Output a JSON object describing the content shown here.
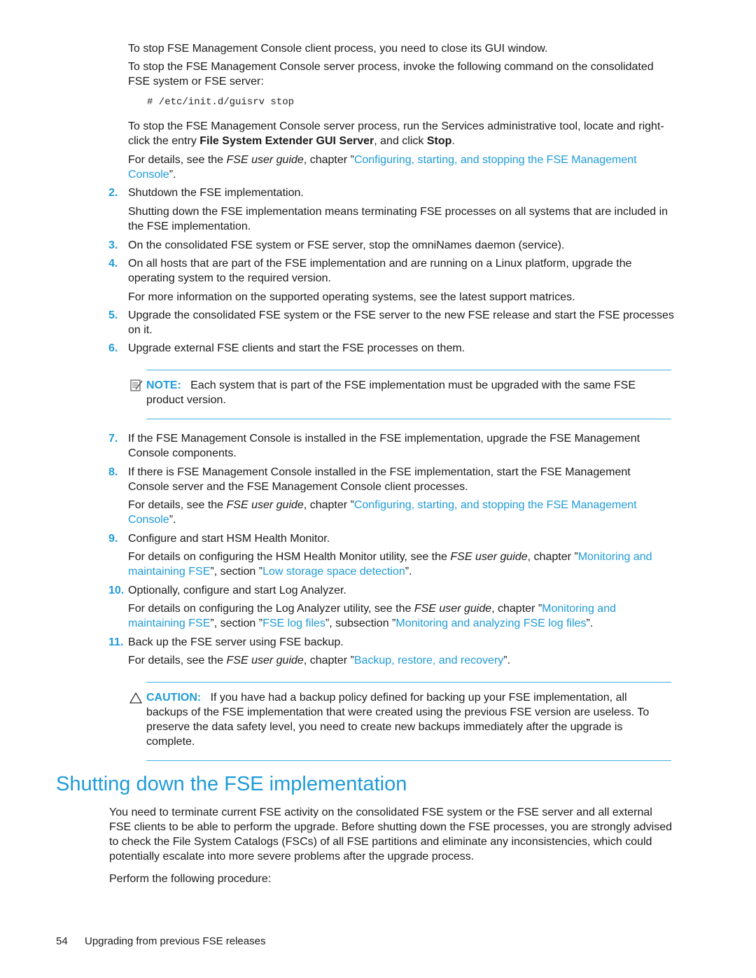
{
  "paragraphs": {
    "p1": "To stop FSE Management Console client process, you need to close its GUI window.",
    "p2": "To stop the FSE Management Console server process, invoke the following command on the consolidated FSE system or FSE server:",
    "cmd": "# /etc/init.d/guisrv stop",
    "p3a": "To stop the FSE Management Console server process, run the Services administrative tool, locate and right-click the entry ",
    "p3b": "File System Extender GUI Server",
    "p3c": ", and click ",
    "p3d": "Stop",
    "p3e": ".",
    "p4a": "For details, see the ",
    "p4b": "FSE user guide",
    "p4c": ", chapter ”",
    "p4link": "Configuring, starting, and stopping the FSE Management Console",
    "p4d": "”."
  },
  "steps": [
    {
      "num": "2.",
      "text": "Shutdown the FSE implementation.",
      "sub": "Shutting down the FSE implementation means terminating FSE processes on all systems that are included in the FSE implementation."
    },
    {
      "num": "3.",
      "text": "On the consolidated FSE system or FSE server, stop the omniNames daemon (service)."
    },
    {
      "num": "4.",
      "text": "On all hosts that are part of the FSE implementation and are running on a Linux platform, upgrade the operating system to the required version.",
      "sub": "For more information on the supported operating systems, see the latest support matrices."
    },
    {
      "num": "5.",
      "text": "Upgrade the consolidated FSE system or the FSE server to the new FSE release and start the FSE processes on it."
    },
    {
      "num": "6.",
      "text": "Upgrade external FSE clients and start the FSE processes on them."
    },
    {
      "num": "7.",
      "text": "If the FSE Management Console is installed in the FSE implementation, upgrade the FSE Management Console components."
    },
    {
      "num": "8.",
      "text": "If there is FSE Management Console installed in the FSE implementation, start the FSE Management Console server and the FSE Management Console client processes.",
      "sub_a": "For details, see the ",
      "sub_i": "FSE user guide",
      "sub_b": ", chapter ”",
      "sub_link": "Configuring, starting, and stopping the FSE Management Console",
      "sub_c": "”."
    },
    {
      "num": "9.",
      "text": "Configure and start HSM Health Monitor.",
      "sub_a": "For details on configuring the HSM Health Monitor utility, see the ",
      "sub_i": "FSE user guide",
      "sub_b": ", chapter ”",
      "sub_link": "Monitoring and maintaining FSE",
      "sub_c": "”, section ”",
      "sub_link2": "Low storage space detection",
      "sub_d": "”."
    },
    {
      "num": "10.",
      "text": "Optionally, configure and start Log Analyzer.",
      "sub_a": "For details on configuring the Log Analyzer utility, see the ",
      "sub_i": "FSE user guide",
      "sub_b": ", chapter ”",
      "sub_link": "Monitoring and maintaining FSE",
      "sub_c": "”, section ”",
      "sub_link2": "FSE log files",
      "sub_d": "”, subsection ”",
      "sub_link3": "Monitoring and analyzing FSE log files",
      "sub_e": "”."
    },
    {
      "num": "11.",
      "text": "Back up the FSE server using FSE backup.",
      "sub_a": "For details, see the ",
      "sub_i": "FSE user guide",
      "sub_b": ", chapter ”",
      "sub_link": "Backup, restore, and recovery",
      "sub_c": "”."
    }
  ],
  "note": {
    "icon": "note-icon",
    "label": "NOTE:",
    "text": "Each system that is part of the FSE implementation must be upgraded with the same FSE product version."
  },
  "caution": {
    "icon": "caution-icon",
    "label": "CAUTION:",
    "text": "If you have had a backup policy defined for backing up your FSE implementation, all backups of the FSE implementation that were created using the previous FSE version are useless. To preserve the data safety level, you need to create new backups immediately after the upgrade is complete."
  },
  "section": {
    "title": "Shutting down the FSE implementation",
    "p1": "You need to terminate current FSE activity on the consolidated FSE system or the FSE server and all external FSE clients to be able to perform the upgrade. Before shutting down the FSE processes, you are strongly advised to check the File System Catalogs (FSCs) of all FSE partitions and eliminate any inconsistencies, which could potentially escalate into more severe problems after the upgrade process.",
    "p2": "Perform the following procedure:"
  },
  "footer": {
    "page": "54",
    "title": "Upgrading from previous FSE releases"
  },
  "colors": {
    "accent": "#1f9bd7",
    "rule": "#3fb2e0",
    "text": "#1a1a1a"
  }
}
